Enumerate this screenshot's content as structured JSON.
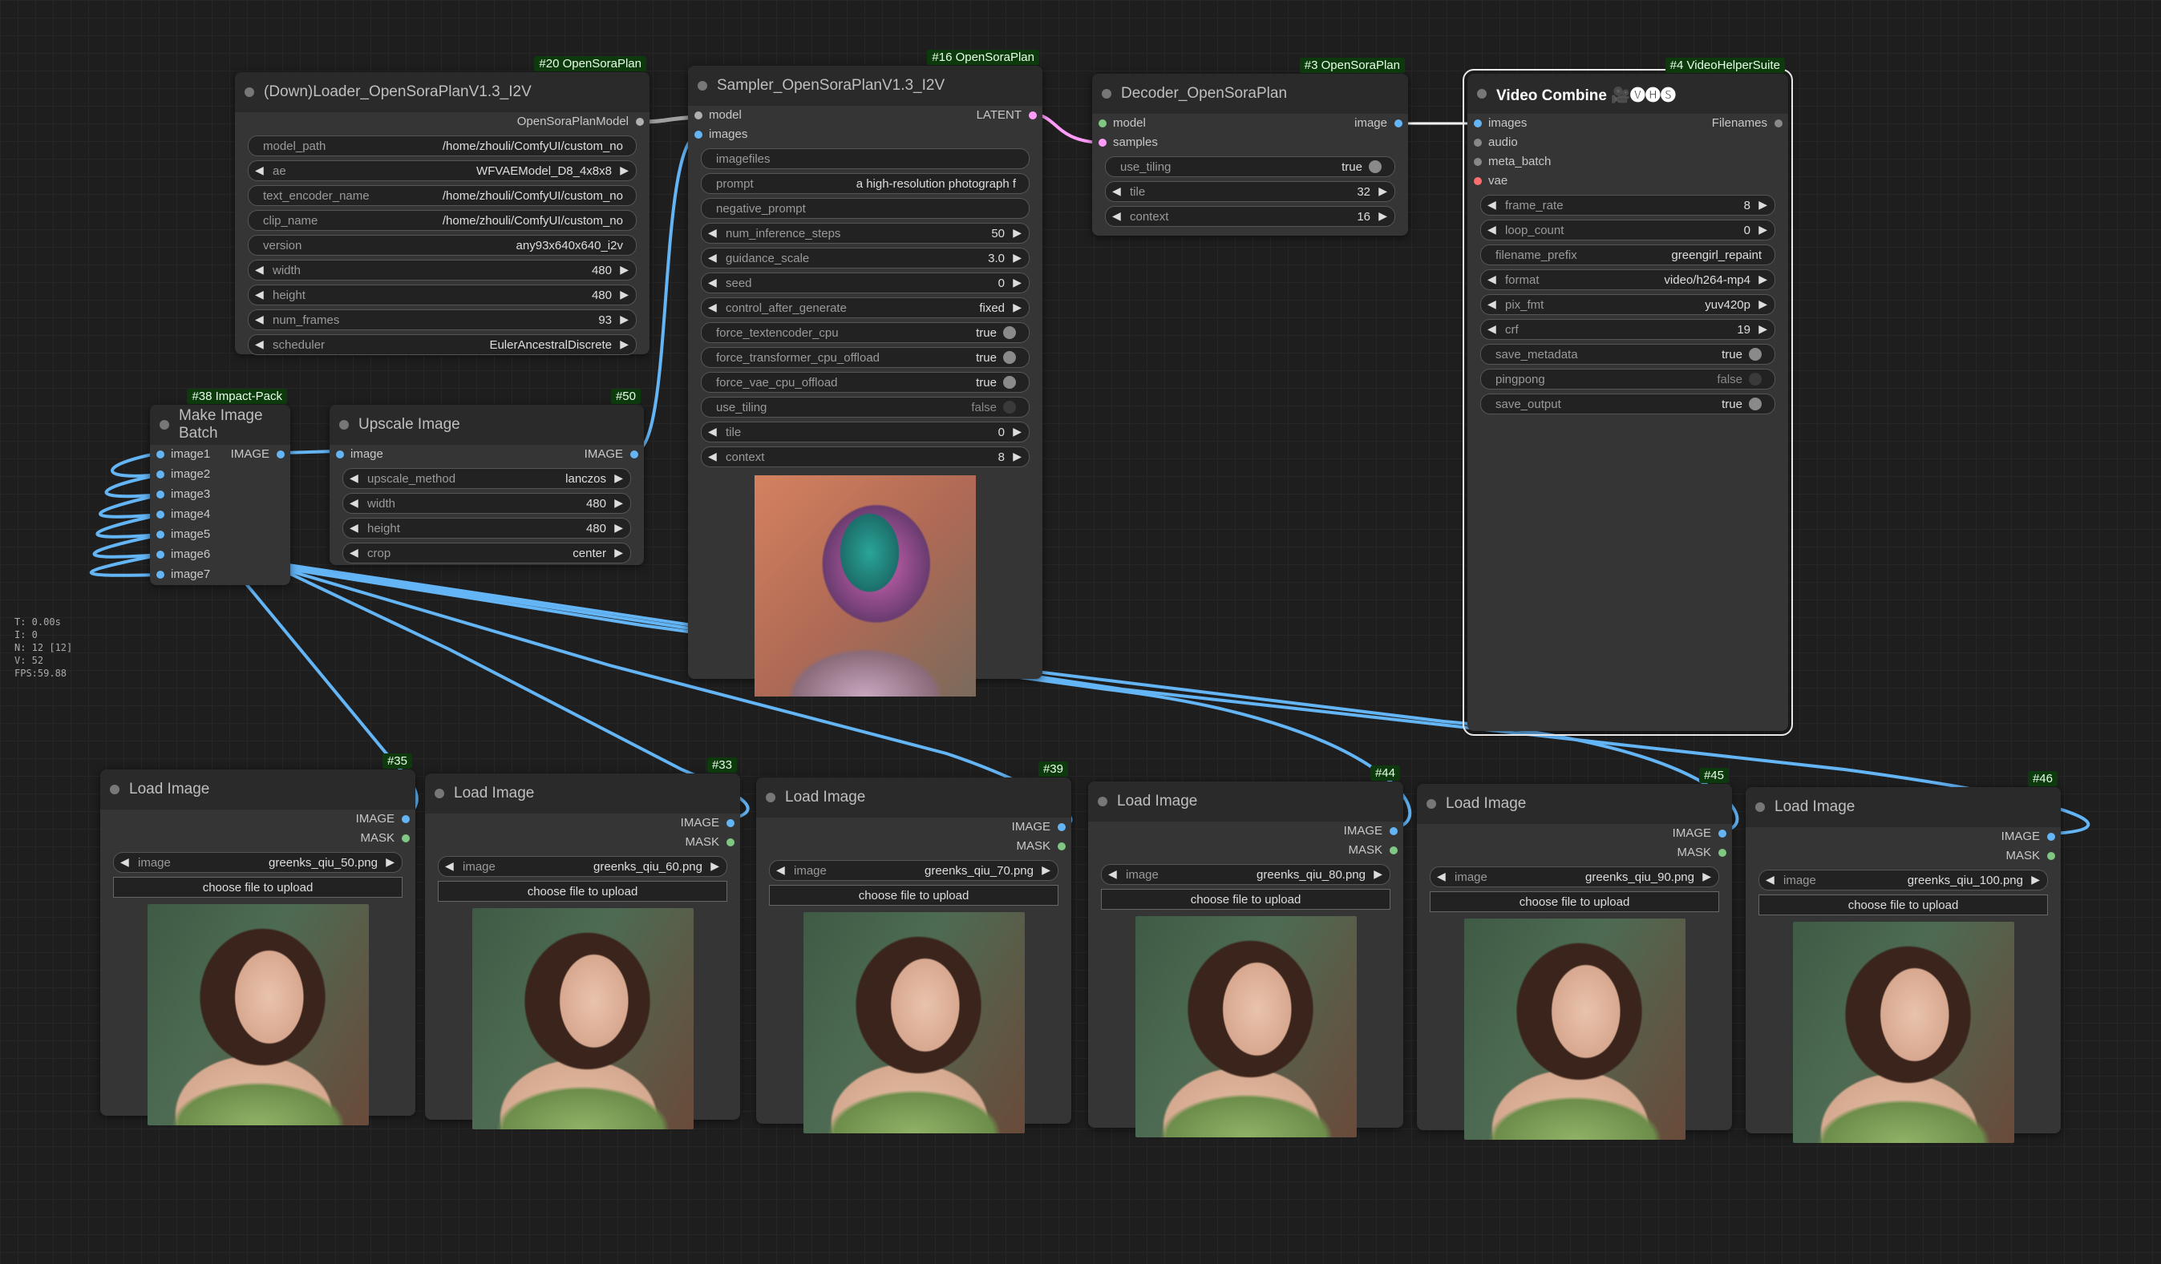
{
  "stats": [
    "T: 0.00s",
    "I: 0",
    "N: 12 [12]",
    "V: 52",
    "FPS:59.88"
  ],
  "loader": {
    "title": "(Down)Loader_OpenSoraPlanV1.3_I2V",
    "badge": "#20 OpenSoraPlan",
    "out": "OpenSoraPlanModel",
    "widgets": [
      {
        "label": "model_path",
        "value": "/home/zhouli/ComfyUI/custom_no"
      },
      {
        "label": "ae",
        "value": "WFVAEModel_D8_4x8x8"
      },
      {
        "label": "text_encoder_name",
        "value": "/home/zhouli/ComfyUI/custom_no"
      },
      {
        "label": "clip_name",
        "value": "/home/zhouli/ComfyUI/custom_no"
      },
      {
        "label": "version",
        "value": "any93x640x640_i2v"
      },
      {
        "label": "width",
        "value": "480"
      },
      {
        "label": "height",
        "value": "480"
      },
      {
        "label": "num_frames",
        "value": "93"
      },
      {
        "label": "scheduler",
        "value": "EulerAncestralDiscrete"
      }
    ]
  },
  "sampler": {
    "title": "Sampler_OpenSoraPlanV1.3_I2V",
    "badge": "#16 OpenSoraPlan",
    "in1": "model",
    "in2": "images",
    "out": "LATENT",
    "widgets": [
      {
        "label": "imagefiles",
        "value": ""
      },
      {
        "label": "prompt",
        "value": "a high-resolution photograph f"
      },
      {
        "label": "negative_prompt",
        "value": ""
      },
      {
        "label": "num_inference_steps",
        "value": "50"
      },
      {
        "label": "guidance_scale",
        "value": "3.0"
      },
      {
        "label": "seed",
        "value": "0"
      },
      {
        "label": "control_after_generate",
        "value": "fixed"
      },
      {
        "label": "force_textencoder_cpu",
        "value": "true"
      },
      {
        "label": "force_transformer_cpu_offload",
        "value": "true"
      },
      {
        "label": "force_vae_cpu_offload",
        "value": "true"
      },
      {
        "label": "use_tiling",
        "value": "false"
      },
      {
        "label": "tile",
        "value": "0"
      },
      {
        "label": "context",
        "value": "8"
      }
    ]
  },
  "decoder": {
    "title": "Decoder_OpenSoraPlan",
    "badge": "#3 OpenSoraPlan",
    "in1": "model",
    "in2": "samples",
    "out": "image",
    "widgets": [
      {
        "label": "use_tiling",
        "value": "true"
      },
      {
        "label": "tile",
        "value": "32"
      },
      {
        "label": "context",
        "value": "16"
      }
    ]
  },
  "combine": {
    "title": "Video Combine 🎥🅥🅗🅢",
    "badge": "#4 VideoHelperSuite",
    "inputs": [
      "images",
      "audio",
      "meta_batch",
      "vae"
    ],
    "out": "Filenames",
    "widgets": [
      {
        "label": "frame_rate",
        "value": "8"
      },
      {
        "label": "loop_count",
        "value": "0"
      },
      {
        "label": "filename_prefix",
        "value": "greengirl_repaint"
      },
      {
        "label": "format",
        "value": "video/h264-mp4"
      },
      {
        "label": "pix_fmt",
        "value": "yuv420p"
      },
      {
        "label": "crf",
        "value": "19"
      },
      {
        "label": "save_metadata",
        "value": "true"
      },
      {
        "label": "pingpong",
        "value": "false"
      },
      {
        "label": "save_output",
        "value": "true"
      }
    ]
  },
  "batch": {
    "title": "Make Image Batch",
    "badge": "#38 Impact-Pack",
    "out": "IMAGE",
    "inputs": [
      "image1",
      "image2",
      "image3",
      "image4",
      "image5",
      "image6",
      "image7"
    ]
  },
  "upscale": {
    "title": "Upscale Image",
    "badge": "#50",
    "in": "image",
    "out": "IMAGE",
    "widgets": [
      {
        "label": "upscale_method",
        "value": "lanczos"
      },
      {
        "label": "width",
        "value": "480"
      },
      {
        "label": "height",
        "value": "480"
      },
      {
        "label": "crop",
        "value": "center"
      }
    ]
  },
  "loads": [
    {
      "title": "Load Image",
      "badge": "#35",
      "file": "greenks_qiu_50.png"
    },
    {
      "title": "Load Image",
      "badge": "#33",
      "file": "greenks_qiu_60.png"
    },
    {
      "title": "Load Image",
      "badge": "#39",
      "file": "greenks_qiu_70.png"
    },
    {
      "title": "Load Image",
      "badge": "#44",
      "file": "greenks_qiu_80.png"
    },
    {
      "title": "Load Image",
      "badge": "#45",
      "file": "greenks_qiu_90.png"
    },
    {
      "title": "Load Image",
      "badge": "#46",
      "file": "greenks_qiu_100.png"
    }
  ],
  "load_common": {
    "out1": "IMAGE",
    "out2": "MASK",
    "image_label": "image",
    "upload": "choose file to upload"
  },
  "colors": {
    "wire_image": "#64b5f6",
    "wire_latent": "#ff9cf9",
    "wire_model": "#a0a0a0",
    "pin_image": "#64b5f6",
    "pin_model": "#b0b0b0",
    "pin_vae": "#ff6e6e",
    "pin_mask": "#81c784"
  }
}
